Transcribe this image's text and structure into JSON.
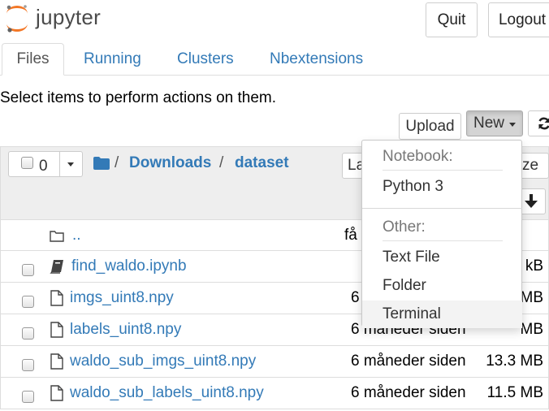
{
  "header": {
    "logo_text": "jupyter",
    "quit_label": "Quit",
    "logout_label": "Logout"
  },
  "tabs": [
    {
      "label": "Files",
      "active": true
    },
    {
      "label": "Running",
      "active": false
    },
    {
      "label": "Clusters",
      "active": false
    },
    {
      "label": "Nbextensions",
      "active": false
    }
  ],
  "hint": "Select items to perform actions on them.",
  "toolbar": {
    "upload_label": "Upload",
    "new_label": "New",
    "refresh_icon": "refresh-icon"
  },
  "list_header": {
    "selected_count": "0",
    "breadcrumb": {
      "root_sep": "/",
      "items": [
        "Downloads",
        "dataset"
      ],
      "sep": "/"
    },
    "name_sort_partial": "La",
    "size_sort_partial": "ze"
  },
  "rows": [
    {
      "name": "..",
      "icon": "folder-icon",
      "modified": "få",
      "size": ""
    },
    {
      "name": "find_waldo.ipynb",
      "icon": "notebook-icon",
      "modified": "",
      "size": "kB"
    },
    {
      "name": "imgs_uint8.npy",
      "icon": "file-icon",
      "modified": "6",
      "size": "MB"
    },
    {
      "name": "labels_uint8.npy",
      "icon": "file-icon",
      "modified": "6 måneder siden",
      "size": "MB"
    },
    {
      "name": "waldo_sub_imgs_uint8.npy",
      "icon": "file-icon",
      "modified": "6 måneder siden",
      "size": "13.3 MB"
    },
    {
      "name": "waldo_sub_labels_uint8.npy",
      "icon": "file-icon",
      "modified": "6 måneder siden",
      "size": "11.5 MB"
    }
  ],
  "new_menu": {
    "notebook_header": "Notebook:",
    "notebook_items": [
      "Python 3"
    ],
    "other_header": "Other:",
    "other_items": [
      "Text File",
      "Folder",
      "Terminal"
    ]
  },
  "colors": {
    "link": "#337ab7",
    "logo_orange": "#f37726"
  }
}
